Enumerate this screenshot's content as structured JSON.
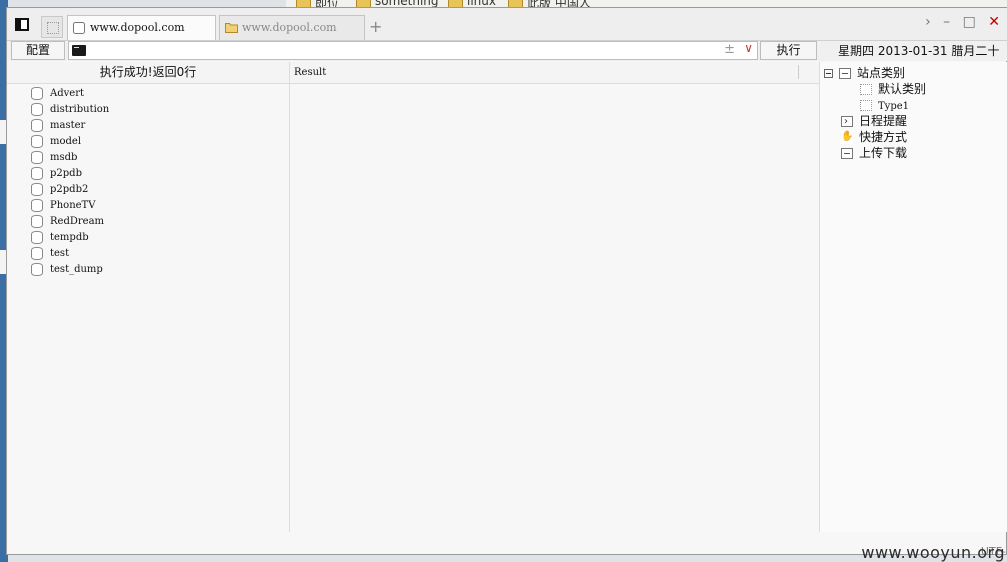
{
  "background": {
    "folders": [
      "即位",
      "something",
      "linux",
      "此版 中国人"
    ]
  },
  "tabs": [
    {
      "label": "www.dopool.com",
      "active": true,
      "icon": "page-icon"
    },
    {
      "label": "www.dopool.com",
      "active": false,
      "icon": "folder-icon"
    }
  ],
  "toolbar": {
    "config_label": "配置",
    "command_value": "",
    "plus_minus": "±",
    "execute_label": "执行",
    "date_text": "星期四 2013-01-31 腊月二十"
  },
  "left_panel": {
    "header": "执行成功!返回0行",
    "databases": [
      "Advert",
      "distribution",
      "master",
      "model",
      "msdb",
      "p2pdb",
      "p2pdb2",
      "PhoneTV",
      "RedDream",
      "tempdb",
      "test",
      "test_dump"
    ]
  },
  "result_panel": {
    "header": "Result"
  },
  "tree": {
    "root_label": "站点类别",
    "children": [
      "默认类别",
      "Type1"
    ],
    "items": [
      "日程提醒",
      "快捷方式",
      "上传下载"
    ]
  },
  "status": {
    "encoding": "UTF-"
  },
  "watermark": "www.wooyun.org",
  "colors": {
    "window_bg": "#f7f7f7",
    "close_button": "#c00000",
    "dropdown_caret": "#c0392b"
  }
}
